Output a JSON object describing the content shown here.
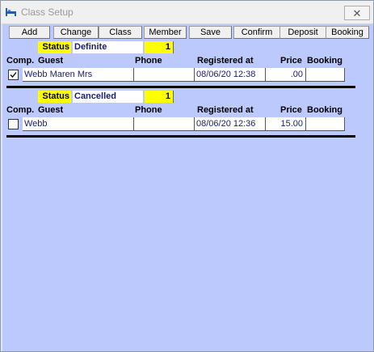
{
  "window": {
    "title": "Class Setup",
    "close_glyph": "✕"
  },
  "toolbar": {
    "buttons": [
      {
        "label": "Add"
      },
      {
        "label": "Change"
      },
      {
        "label": "Class"
      },
      {
        "label": "Member"
      },
      {
        "label": "Save"
      },
      {
        "label": "Confirm"
      },
      {
        "label": "Deposit"
      },
      {
        "label": "Booking"
      }
    ]
  },
  "columns": {
    "comp": "Comp.",
    "guest": "Guest",
    "phone": "Phone",
    "registered": "Registered at",
    "price": "Price",
    "booking": "Booking"
  },
  "groups": [
    {
      "status_label": "Status",
      "status_value": "Definite",
      "count": "1",
      "rows": [
        {
          "comp_checked": true,
          "guest": "Webb Maren Mrs",
          "phone": "",
          "registered": "08/06/20 12:38",
          "price": ".00",
          "booking": ""
        }
      ]
    },
    {
      "status_label": "Status",
      "status_value": "Cancelled",
      "count": "1",
      "rows": [
        {
          "comp_checked": false,
          "guest": "Webb",
          "phone": "",
          "registered": "08/06/20 12:36",
          "price": "15.00",
          "booking": ""
        }
      ]
    }
  ],
  "colors": {
    "background": "#bcc9fd",
    "status_highlight": "#ffff00",
    "value_text": "#1a1e6e"
  }
}
